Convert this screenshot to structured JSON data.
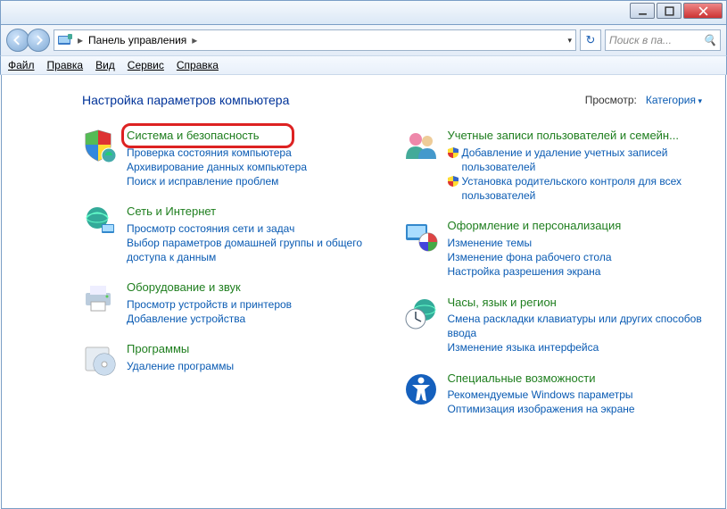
{
  "window": {
    "breadcrumb_root": "Панель управления",
    "search_placeholder": "Поиск в па..."
  },
  "menu": {
    "file": "Файл",
    "edit": "Правка",
    "view": "Вид",
    "tools": "Сервис",
    "help": "Справка"
  },
  "page": {
    "title": "Настройка параметров компьютера",
    "viewby_label": "Просмотр:",
    "viewby_value": "Категория"
  },
  "cats": {
    "system": {
      "title": "Система и безопасность",
      "links": [
        "Проверка состояния компьютера",
        "Архивирование данных компьютера",
        "Поиск и исправление проблем"
      ]
    },
    "network": {
      "title": "Сеть и Интернет",
      "links": [
        "Просмотр состояния сети и задач",
        "Выбор параметров домашней группы и общего доступа к данным"
      ]
    },
    "hardware": {
      "title": "Оборудование и звук",
      "links": [
        "Просмотр устройств и принтеров",
        "Добавление устройства"
      ]
    },
    "programs": {
      "title": "Программы",
      "links": [
        "Удаление программы"
      ]
    },
    "users": {
      "title": "Учетные записи пользователей и семейн...",
      "links": [
        "Добавление и удаление учетных записей пользователей",
        "Установка родительского контроля для всех пользователей"
      ]
    },
    "appearance": {
      "title": "Оформление и персонализация",
      "links": [
        "Изменение темы",
        "Изменение фона рабочего стола",
        "Настройка разрешения экрана"
      ]
    },
    "clock": {
      "title": "Часы, язык и регион",
      "links": [
        "Смена раскладки клавиатуры или других способов ввода",
        "Изменение языка интерфейса"
      ]
    },
    "access": {
      "title": "Специальные возможности",
      "links": [
        "Рекомендуемые Windows параметры",
        "Оптимизация изображения на экране"
      ]
    }
  }
}
